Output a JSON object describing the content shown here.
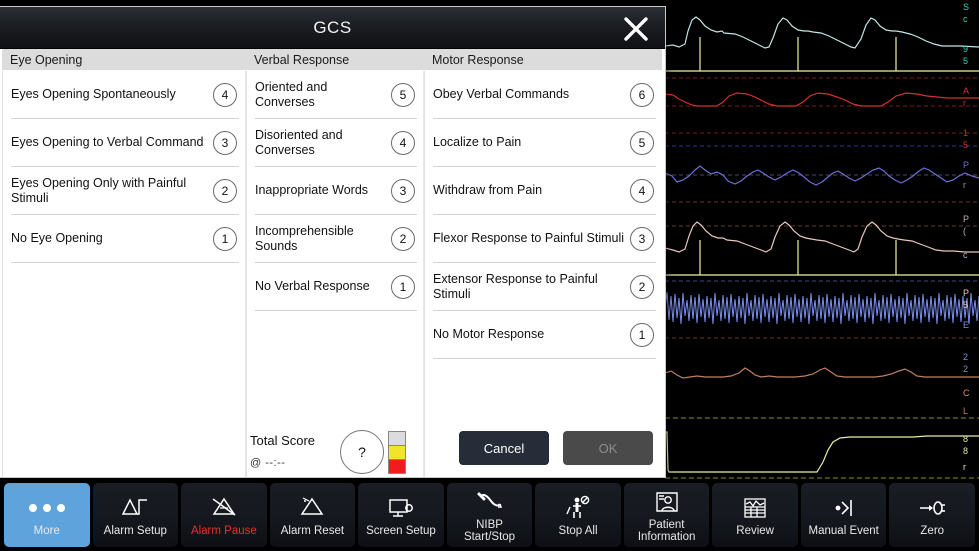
{
  "dialog": {
    "title": "GCS",
    "close_icon": "close-icon",
    "columns": [
      {
        "header": "Eye Opening",
        "items": [
          {
            "label": "Eyes Opening Spontaneously",
            "score": "4"
          },
          {
            "label": "Eyes Opening to Verbal Command",
            "score": "3"
          },
          {
            "label": "Eyes Opening Only with Painful Stimuli",
            "score": "2"
          },
          {
            "label": "No Eye Opening",
            "score": "1"
          }
        ]
      },
      {
        "header": "Verbal Response",
        "items": [
          {
            "label": "Oriented and Converses",
            "score": "5"
          },
          {
            "label": "Disoriented and Converses",
            "score": "4"
          },
          {
            "label": "Inappropriate Words",
            "score": "3"
          },
          {
            "label": "Incomprehensible Sounds",
            "score": "2"
          },
          {
            "label": "No Verbal Response",
            "score": "1"
          }
        ]
      },
      {
        "header": "Motor Response",
        "items": [
          {
            "label": "Obey Verbal Commands",
            "score": "6"
          },
          {
            "label": "Localize to Pain",
            "score": "5"
          },
          {
            "label": "Withdraw from Pain",
            "score": "4"
          },
          {
            "label": "Flexor Response to Painful Stimuli",
            "score": "3"
          },
          {
            "label": "Extensor Response to Painful Stimuli",
            "score": "2"
          },
          {
            "label": "No Motor Response",
            "score": "1"
          }
        ]
      }
    ],
    "total": {
      "label": "Total Score",
      "timestamp": "@ --:--",
      "value": "?",
      "legend_colors": [
        "#dcdcdc",
        "#f2e42b",
        "#f01c20"
      ]
    },
    "footer": {
      "cancel_label": "Cancel",
      "ok_label": "OK"
    }
  },
  "toolbar": {
    "buttons": [
      {
        "label": "More",
        "icon": "more-dots-icon",
        "active": true
      },
      {
        "label": "Alarm Setup",
        "icon": "alarm-setup-icon",
        "active": false
      },
      {
        "label": "Alarm Pause",
        "icon": "alarm-pause-icon",
        "active": false,
        "alert": true
      },
      {
        "label": "Alarm Reset",
        "icon": "alarm-reset-icon",
        "active": false
      },
      {
        "label": "Screen Setup",
        "icon": "screen-setup-icon",
        "active": false
      },
      {
        "label": "NIBP\nStart/Stop",
        "icon": "nibp-cuff-icon",
        "active": false
      },
      {
        "label": "Stop All",
        "icon": "stop-all-icon",
        "active": false
      },
      {
        "label": "Patient\nInformation",
        "icon": "patient-card-icon",
        "active": false
      },
      {
        "label": "Review",
        "icon": "review-table-icon",
        "active": false
      },
      {
        "label": "Manual Event",
        "icon": "manual-event-icon",
        "active": false
      },
      {
        "label": "Zero",
        "icon": "zero-icon",
        "active": false
      }
    ],
    "accent_color": "#5fa3dd",
    "alert_color": "#e8322c"
  },
  "waveforms": {
    "background": "#000000",
    "traces": [
      {
        "name": "pleth-upper",
        "color": "#bfe8e2"
      },
      {
        "name": "pacer-baseline",
        "color": "#f2f2a0"
      },
      {
        "name": "art-pressure",
        "color": "#d4302c"
      },
      {
        "name": "cvp-pressure",
        "color": "#6f6fd8"
      },
      {
        "name": "pleth-lower",
        "color": "#e8c8c0"
      },
      {
        "name": "eeg-fast",
        "color": "#7b8ff0"
      },
      {
        "name": "resp-brown",
        "color": "#c08060"
      },
      {
        "name": "co2-step",
        "color": "#e8f0a0"
      }
    ],
    "gridline_color": "#5a1414"
  }
}
